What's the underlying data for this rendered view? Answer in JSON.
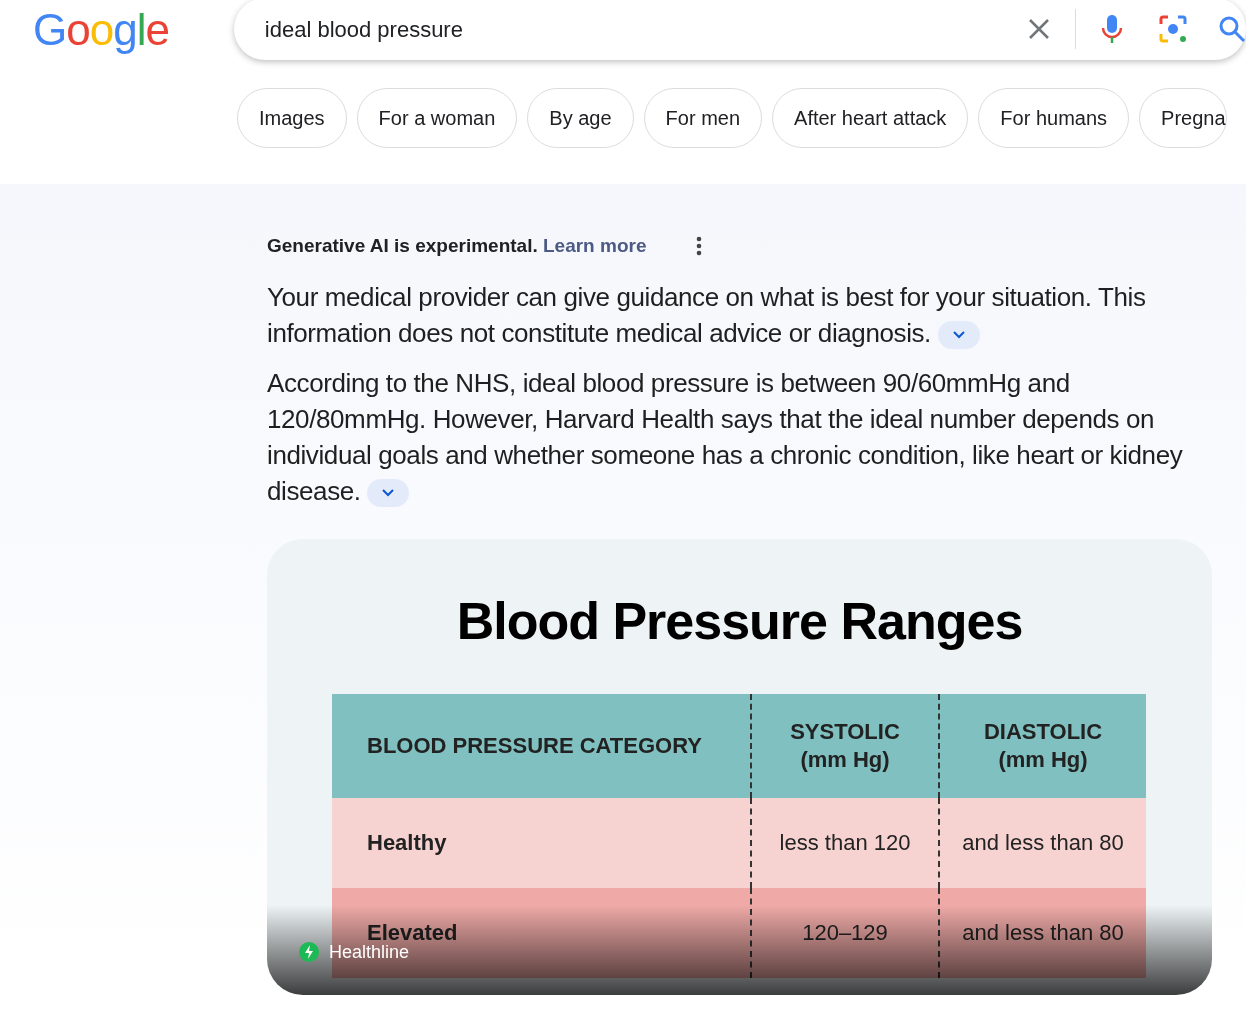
{
  "logo": "Google",
  "search": {
    "value": "ideal blood pressure"
  },
  "chips": [
    {
      "label": "Images"
    },
    {
      "label": "For a woman"
    },
    {
      "label": "By age"
    },
    {
      "label": "For men"
    },
    {
      "label": "After heart attack"
    },
    {
      "label": "For humans"
    },
    {
      "label": "Pregna"
    }
  ],
  "ai_overview": {
    "notice": "Generative AI is experimental.",
    "learn_more": "Learn more",
    "paragraphs": [
      "Your medical provider can give guidance on what is best for your situation. This information does not constitute medical advice or diagnosis.",
      "According to the NHS, ideal blood pressure is between 90/60mmHg and 120/80mmHg. However, Harvard Health says that the ideal number depends on individual goals and whether someone has a chronic condition, like heart or kidney disease."
    ],
    "image": {
      "title": "Blood Pressure Ranges",
      "columns": [
        "BLOOD PRESSURE CATEGORY",
        "SYSTOLIC (mm Hg)",
        "DIASTOLIC (mm Hg)"
      ],
      "rows": [
        {
          "cells": [
            "Healthy",
            "less than 120",
            "and less than 80"
          ],
          "color": "#f6d3d1"
        },
        {
          "cells": [
            "Elevated",
            "120–129",
            "and less than 80"
          ],
          "color": "#efaaa7"
        }
      ],
      "source": "Healthline"
    }
  }
}
